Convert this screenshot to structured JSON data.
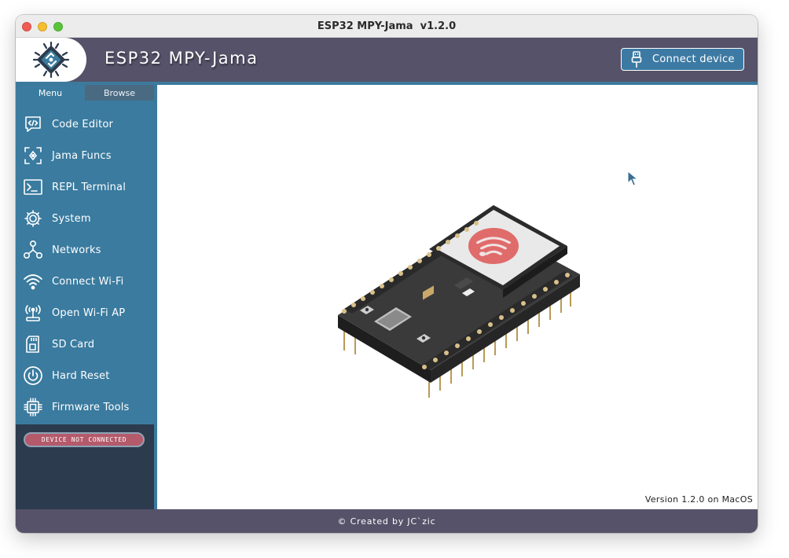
{
  "window": {
    "title": "ESP32 MPY-Jama  v1.2.0"
  },
  "header": {
    "app_name": "ESP32 MPY-Jama",
    "logo_icon": "chip-logo-icon",
    "connect_button": {
      "label": "Connect device",
      "icon": "usb-plug-icon"
    }
  },
  "sidebar": {
    "tabs": [
      {
        "label": "Menu",
        "active": true
      },
      {
        "label": "Browse",
        "active": false
      }
    ],
    "items": [
      {
        "label": "Code Editor",
        "icon": "code-editor-icon"
      },
      {
        "label": "Jama Funcs",
        "icon": "jama-funcs-icon"
      },
      {
        "label": "REPL Terminal",
        "icon": "terminal-icon"
      },
      {
        "label": "System",
        "icon": "system-gear-icon"
      },
      {
        "label": "Networks",
        "icon": "networks-icon"
      },
      {
        "label": "Connect Wi-Fi",
        "icon": "wifi-icon"
      },
      {
        "label": "Open Wi-Fi AP",
        "icon": "wifi-ap-icon"
      },
      {
        "label": "SD Card",
        "icon": "sd-card-icon"
      },
      {
        "label": "Hard Reset",
        "icon": "power-icon"
      },
      {
        "label": "Firmware Tools",
        "icon": "chip-icon"
      }
    ],
    "status_badge": "DEVICE NOT CONNECTED"
  },
  "main": {
    "board_image": "esp32-board-illustration",
    "version_text": "Version 1.2.0 on MacOS"
  },
  "footer": {
    "text": "© Created by JC`zic"
  },
  "colors": {
    "header_bg": "#555269",
    "sidebar_menu_bg": "#3a7b9f",
    "sidebar_dark_bg": "#2c3b4d",
    "badge_bg": "#b45a6b",
    "accent": "#3c7a9d"
  }
}
